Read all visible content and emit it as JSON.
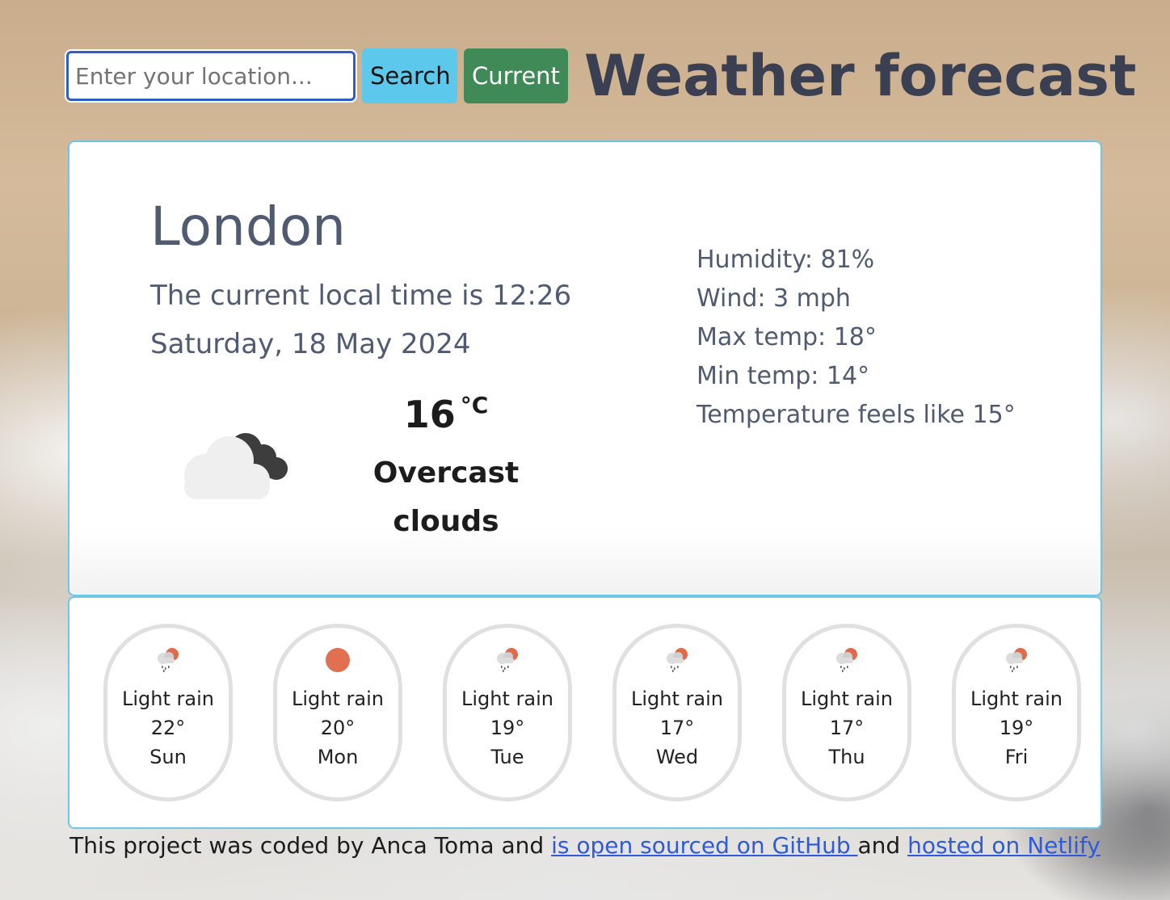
{
  "search": {
    "placeholder": "Enter your location...",
    "value": ""
  },
  "buttons": {
    "search_label": "Search",
    "current_label": "Current"
  },
  "app_title": "Weather forecast",
  "current": {
    "city": "London",
    "local_time_text": "The current local time is 12:26",
    "date": "Saturday, 18 May 2024",
    "temperature": "16",
    "unit": "°C",
    "condition": "Overcast clouds",
    "icon": "overcast-clouds-icon",
    "details": [
      "Humidity: 81%",
      "Wind: 3 mph",
      "Max temp: 18°",
      "Min temp: 14°",
      "Temperature feels like 15°"
    ]
  },
  "forecast": [
    {
      "desc": "Light rain",
      "temp": "22°",
      "day": "Sun",
      "icon": "light-rain-icon"
    },
    {
      "desc": "Light rain",
      "temp": "20°",
      "day": "Mon",
      "icon": "sun-icon"
    },
    {
      "desc": "Light rain",
      "temp": "19°",
      "day": "Tue",
      "icon": "light-rain-icon"
    },
    {
      "desc": "Light rain",
      "temp": "17°",
      "day": "Wed",
      "icon": "light-rain-icon"
    },
    {
      "desc": "Light rain",
      "temp": "17°",
      "day": "Thu",
      "icon": "light-rain-icon"
    },
    {
      "desc": "Light rain",
      "temp": "19°",
      "day": "Fri",
      "icon": "light-rain-icon"
    }
  ],
  "footer": {
    "text_before": "This project was coded by Anca Toma and ",
    "link_github": "is open sourced on GitHub ",
    "text_middle": "and ",
    "link_netlify": "hosted on Netlify"
  },
  "colors": {
    "accent_border": "#6fc6e6",
    "search_button": "#5bc8ec",
    "current_button": "#3f8a57",
    "title": "#3a3f52",
    "link": "#2f5ad8"
  }
}
